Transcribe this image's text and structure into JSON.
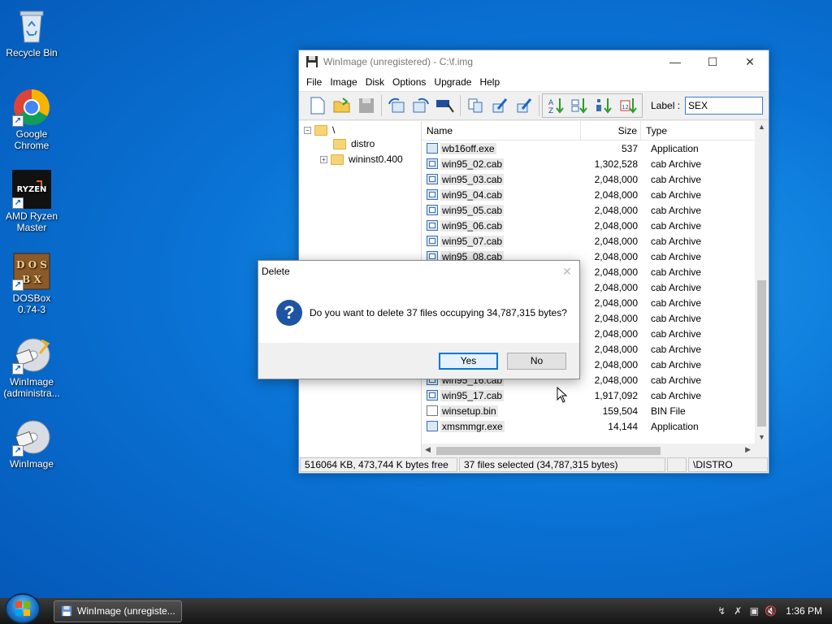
{
  "desktop": {
    "icons": [
      {
        "label": "Recycle Bin"
      },
      {
        "label": "Google Chrome"
      },
      {
        "label": "AMD Ryzen Master"
      },
      {
        "label": "DOSBox 0.74-3"
      },
      {
        "label": "WinImage (administra..."
      },
      {
        "label": "WinImage"
      }
    ]
  },
  "window": {
    "title": "WinImage (unregistered) - C:\\f.img",
    "menu": [
      "File",
      "Image",
      "Disk",
      "Options",
      "Upgrade",
      "Help"
    ],
    "label_text": "Label :",
    "label_value": "SEX",
    "tree": {
      "root": "\\",
      "children": [
        "distro",
        "wininst0.400"
      ]
    },
    "columns": {
      "name": "Name",
      "size": "Size",
      "type": "Type"
    },
    "files": [
      {
        "name": "wb16off.exe",
        "size": "537",
        "type": "Application",
        "icon": "exe"
      },
      {
        "name": "win95_02.cab",
        "size": "1,302,528",
        "type": "cab Archive",
        "icon": "cab"
      },
      {
        "name": "win95_03.cab",
        "size": "2,048,000",
        "type": "cab Archive",
        "icon": "cab"
      },
      {
        "name": "win95_04.cab",
        "size": "2,048,000",
        "type": "cab Archive",
        "icon": "cab"
      },
      {
        "name": "win95_05.cab",
        "size": "2,048,000",
        "type": "cab Archive",
        "icon": "cab"
      },
      {
        "name": "win95_06.cab",
        "size": "2,048,000",
        "type": "cab Archive",
        "icon": "cab"
      },
      {
        "name": "win95_07.cab",
        "size": "2,048,000",
        "type": "cab Archive",
        "icon": "cab"
      },
      {
        "name": "win95_08.cab",
        "size": "2,048,000",
        "type": "cab Archive",
        "icon": "cab"
      },
      {
        "name": "",
        "size": "2,048,000",
        "type": "cab Archive",
        "icon": "cab"
      },
      {
        "name": "",
        "size": "2,048,000",
        "type": "cab Archive",
        "icon": "cab"
      },
      {
        "name": "",
        "size": "2,048,000",
        "type": "cab Archive",
        "icon": "cab"
      },
      {
        "name": "",
        "size": "2,048,000",
        "type": "cab Archive",
        "icon": "cab"
      },
      {
        "name": "",
        "size": "2,048,000",
        "type": "cab Archive",
        "icon": "cab"
      },
      {
        "name": "",
        "size": "2,048,000",
        "type": "cab Archive",
        "icon": "cab"
      },
      {
        "name": "",
        "size": "2,048,000",
        "type": "cab Archive",
        "icon": "cab"
      },
      {
        "name": "win95_16.cab",
        "size": "2,048,000",
        "type": "cab Archive",
        "icon": "cab"
      },
      {
        "name": "win95_17.cab",
        "size": "1,917,092",
        "type": "cab Archive",
        "icon": "cab"
      },
      {
        "name": "winsetup.bin",
        "size": "159,504",
        "type": "BIN File",
        "icon": "bin"
      },
      {
        "name": "xmsmmgr.exe",
        "size": "14,144",
        "type": "Application",
        "icon": "exe"
      }
    ],
    "status": {
      "free": "516064 KB, 473,744 K bytes free",
      "selected": "37 files selected (34,787,315 bytes)",
      "path": "\\DISTRO"
    }
  },
  "dialog": {
    "title": "Delete",
    "message": "Do you want to delete 37 files occupying 34,787,315 bytes?",
    "yes": "Yes",
    "no": "No"
  },
  "taskbar": {
    "task_label": "WinImage (unregiste...",
    "clock": "1:36 PM"
  }
}
